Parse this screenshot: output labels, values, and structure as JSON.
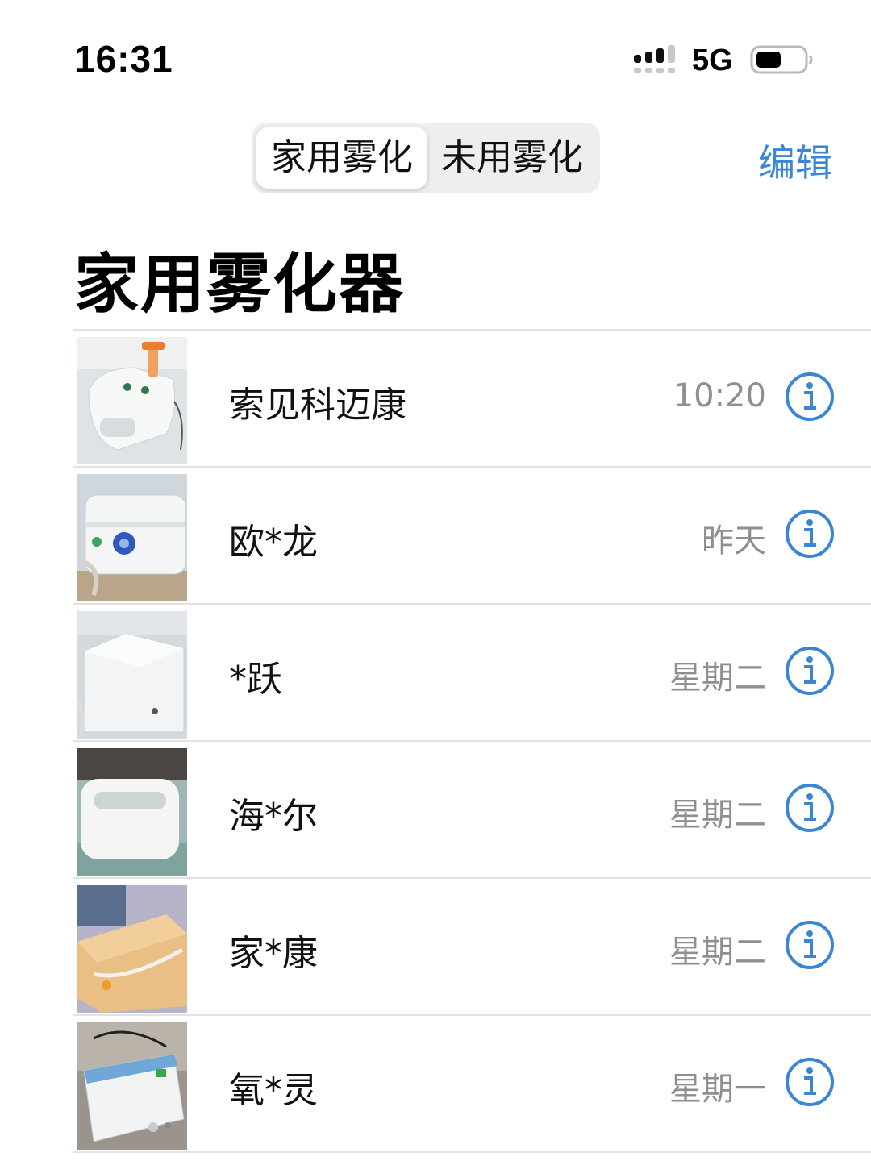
{
  "status_bar": {
    "time": "16:31",
    "network": "5G",
    "icons": [
      "signal-icon",
      "battery-icon"
    ]
  },
  "nav": {
    "segments": [
      {
        "label": "家用雾化",
        "selected": true
      },
      {
        "label": "未用雾化",
        "selected": false
      }
    ],
    "edit_label": "编辑"
  },
  "title": "家用雾化器",
  "colors": {
    "accent": "#3a86d4",
    "secondary_text": "#8e8e93",
    "separator": "#e2e2e2"
  },
  "items": [
    {
      "name": "索见科迈康",
      "time": "10:20",
      "icon": "info-icon"
    },
    {
      "name": "欧*龙",
      "time": "昨天",
      "icon": "info-icon"
    },
    {
      "name": "*跃",
      "time": "星期二",
      "icon": "info-icon"
    },
    {
      "name": "海*尔",
      "time": "星期二",
      "icon": "info-icon"
    },
    {
      "name": "家*康",
      "time": "星期二",
      "icon": "info-icon"
    },
    {
      "name": "氧*灵",
      "time": "星期一",
      "icon": "info-icon"
    }
  ]
}
